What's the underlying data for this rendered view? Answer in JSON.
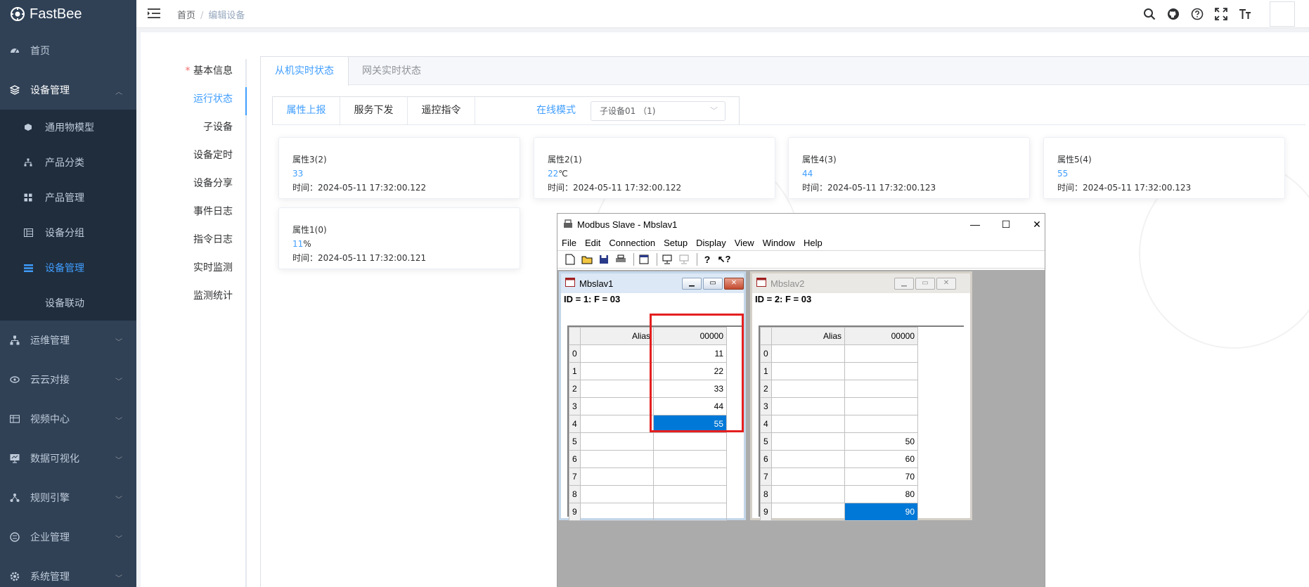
{
  "app": {
    "name": "FastBee"
  },
  "sidebar": {
    "items": [
      {
        "label": "首页",
        "icon": "dashboard-icon"
      },
      {
        "label": "设备管理",
        "icon": "devices-icon"
      },
      {
        "label": "运维管理",
        "icon": "ops-icon"
      },
      {
        "label": "云云对接",
        "icon": "cloud-link-icon"
      },
      {
        "label": "视频中心",
        "icon": "video-icon"
      },
      {
        "label": "数据可视化",
        "icon": "visualization-icon"
      },
      {
        "label": "规则引擎",
        "icon": "rule-engine-icon"
      },
      {
        "label": "企业管理",
        "icon": "enterprise-icon"
      },
      {
        "label": "系统管理",
        "icon": "settings-icon"
      }
    ],
    "sub_items": [
      {
        "label": "通用物模型",
        "icon": "cube-icon"
      },
      {
        "label": "产品分类",
        "icon": "tree-icon"
      },
      {
        "label": "产品管理",
        "icon": "grid-icon"
      },
      {
        "label": "设备分组",
        "icon": "group-icon"
      },
      {
        "label": "设备管理",
        "icon": "list-icon",
        "active": true
      },
      {
        "label": "设备联动",
        "icon": ""
      }
    ]
  },
  "header": {
    "breadcrumb": [
      "首页",
      "编辑设备"
    ],
    "icons": [
      "search-icon",
      "github-icon",
      "help-icon",
      "fullscreen-icon",
      "font-size-icon"
    ]
  },
  "left_tabs": [
    "基本信息",
    "运行状态",
    "子设备",
    "设备定时",
    "设备分享",
    "事件日志",
    "指令日志",
    "实时监测",
    "监测统计"
  ],
  "card_tabs": [
    "从机实时状态",
    "网关实时状态"
  ],
  "inner_tabs": [
    "属性上报",
    "服务下发",
    "遥控指令"
  ],
  "online_mode": "在线模式",
  "subdevice_select": "子设备01 （1)",
  "properties": [
    {
      "name": "属性3(2)",
      "value": "33",
      "unit": "",
      "time": "时间：2024-05-11 17:32:00.122"
    },
    {
      "name": "属性2(1)",
      "value": "22",
      "unit": "℃",
      "time": "时间：2024-05-11 17:32:00.122"
    },
    {
      "name": "属性4(3)",
      "value": "44",
      "unit": "",
      "time": "时间：2024-05-11 17:32:00.123"
    },
    {
      "name": "属性5(4)",
      "value": "55",
      "unit": "",
      "time": "时间：2024-05-11 17:32:00.123"
    },
    {
      "name": "属性1(0)",
      "value": "11",
      "unit": "%",
      "time": "时间：2024-05-11 17:32:00.121"
    }
  ],
  "modbus": {
    "title": "Modbus Slave - Mbslav1",
    "menu": [
      "File",
      "Edit",
      "Connection",
      "Setup",
      "Display",
      "View",
      "Window",
      "Help"
    ],
    "children": [
      {
        "title": "Mbslav1",
        "id_line": "ID = 1: F = 03",
        "alias_header": "Alias",
        "value_header": "00000",
        "rows": [
          {
            "r": "0",
            "v": "11"
          },
          {
            "r": "1",
            "v": "22"
          },
          {
            "r": "2",
            "v": "33"
          },
          {
            "r": "3",
            "v": "44"
          },
          {
            "r": "4",
            "v": "55"
          },
          {
            "r": "5",
            "v": ""
          },
          {
            "r": "6",
            "v": ""
          },
          {
            "r": "7",
            "v": ""
          },
          {
            "r": "8",
            "v": ""
          },
          {
            "r": "9",
            "v": ""
          }
        ],
        "selected_row": 4
      },
      {
        "title": "Mbslav2",
        "id_line": "ID = 2: F = 03",
        "alias_header": "Alias",
        "value_header": "00000",
        "rows": [
          {
            "r": "0",
            "v": ""
          },
          {
            "r": "1",
            "v": ""
          },
          {
            "r": "2",
            "v": ""
          },
          {
            "r": "3",
            "v": ""
          },
          {
            "r": "4",
            "v": ""
          },
          {
            "r": "5",
            "v": "50"
          },
          {
            "r": "6",
            "v": "60"
          },
          {
            "r": "7",
            "v": "70"
          },
          {
            "r": "8",
            "v": "80"
          },
          {
            "r": "9",
            "v": "90"
          }
        ],
        "selected_row": 9
      }
    ]
  },
  "colors": {
    "sidebar_bg": "#304156",
    "sidebar_sub_bg": "#1f2d3d",
    "accent": "#409eff",
    "selection": "#0078d7",
    "highlight_box": "#e41f1f"
  }
}
